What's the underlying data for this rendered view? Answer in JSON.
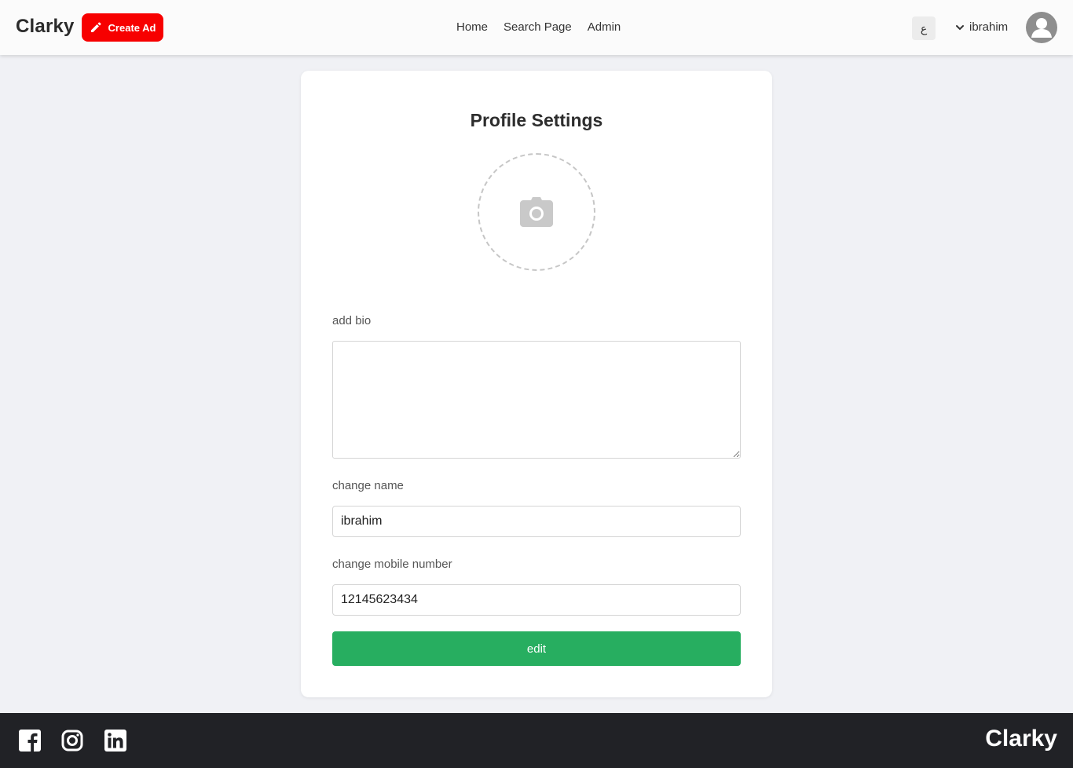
{
  "header": {
    "brand": "Clarky",
    "create_label": "Create Ad",
    "nav": [
      "Home",
      "Search Page",
      "Admin"
    ],
    "lang_toggle": "ع",
    "username": "ibrahim"
  },
  "card": {
    "title": "Profile Settings",
    "bio_label": "add bio",
    "bio_value": "",
    "name_label": "change name",
    "name_value": "ibrahim",
    "mobile_label": "change mobile number",
    "mobile_value": "12145623434",
    "submit_label": "edit"
  },
  "footer": {
    "brand": "Clarky",
    "social_icons": [
      "facebook-icon",
      "instagram-icon",
      "linkedin-icon"
    ]
  },
  "colors": {
    "accent_red": "#f70000",
    "success_green": "#27ae60",
    "footer_bg": "#212226"
  }
}
